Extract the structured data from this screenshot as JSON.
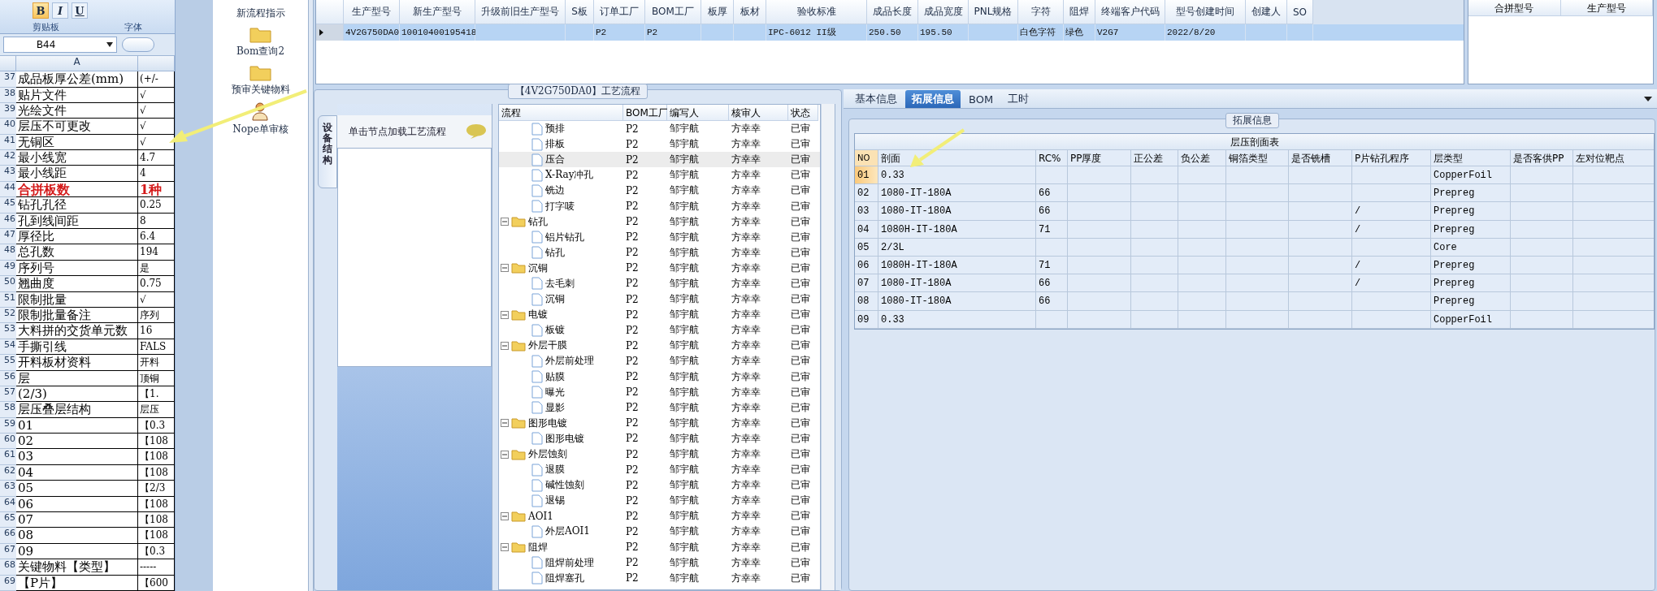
{
  "excel": {
    "format_buttons": [
      {
        "label": "B",
        "on": true
      },
      {
        "label": "I",
        "on": false
      },
      {
        "label": "U",
        "on": false
      }
    ],
    "groups": [
      "剪贴板",
      "字体"
    ],
    "name_box": "B44",
    "column_header": "A",
    "rows": [
      {
        "num": "37",
        "a": "成品板厚公差(mm)",
        "b": "(+/-",
        "emphasis": false
      },
      {
        "num": "38",
        "a": "贴片文件",
        "b": "√",
        "emphasis": false
      },
      {
        "num": "39",
        "a": "光绘文件",
        "b": "√",
        "emphasis": false
      },
      {
        "num": "40",
        "a": "层压不可更改",
        "b": "√",
        "emphasis": false
      },
      {
        "num": "41",
        "a": "无铜区",
        "b": "√",
        "emphasis": false
      },
      {
        "num": "42",
        "a": "最小线宽",
        "b": "4.7",
        "emphasis": false
      },
      {
        "num": "43",
        "a": "最小线距",
        "b": "4",
        "emphasis": false
      },
      {
        "num": "44",
        "a": "合拼板数",
        "b": "1种",
        "emphasis": true
      },
      {
        "num": "45",
        "a": "钻孔孔径",
        "b": "0.25",
        "emphasis": false
      },
      {
        "num": "46",
        "a": "孔到线间距",
        "b": "8",
        "emphasis": false
      },
      {
        "num": "47",
        "a": "厚径比",
        "b": "6.4",
        "emphasis": false
      },
      {
        "num": "48",
        "a": "总孔数",
        "b": "194",
        "emphasis": false
      },
      {
        "num": "49",
        "a": "序列号",
        "b": "是",
        "emphasis": false
      },
      {
        "num": "50",
        "a": "翘曲度",
        "b": "0.75",
        "emphasis": false
      },
      {
        "num": "51",
        "a": "限制批量",
        "b": "√",
        "emphasis": false
      },
      {
        "num": "52",
        "a": "限制批量备注",
        "b": "序列",
        "emphasis": false
      },
      {
        "num": "53",
        "a": "大料拼的交货单元数",
        "b": "16",
        "emphasis": false
      },
      {
        "num": "54",
        "a": "手撕引线",
        "b": "FALS",
        "emphasis": false
      },
      {
        "num": "55",
        "a": "开料板材资料",
        "b": "开料",
        "emphasis": false
      },
      {
        "num": "56",
        "a": "层",
        "b": "顶铜",
        "emphasis": false
      },
      {
        "num": "57",
        "a": "(2/3)",
        "b": "【1.",
        "emphasis": false
      },
      {
        "num": "58",
        "a": "层压叠层结构",
        "b": "层压",
        "emphasis": false
      },
      {
        "num": "59",
        "a": "01",
        "b": "【0.3",
        "emphasis": false
      },
      {
        "num": "60",
        "a": "02",
        "b": "【108",
        "emphasis": false
      },
      {
        "num": "61",
        "a": "03",
        "b": "【108",
        "emphasis": false
      },
      {
        "num": "62",
        "a": "04",
        "b": "【108",
        "emphasis": false
      },
      {
        "num": "63",
        "a": "05",
        "b": "【2/3",
        "emphasis": false
      },
      {
        "num": "64",
        "a": "06",
        "b": "【108",
        "emphasis": false
      },
      {
        "num": "65",
        "a": "07",
        "b": "【108",
        "emphasis": false
      },
      {
        "num": "66",
        "a": "08",
        "b": "【108",
        "emphasis": false
      },
      {
        "num": "67",
        "a": "09",
        "b": "【0.3",
        "emphasis": false
      },
      {
        "num": "68",
        "a": "关键物料【类型】",
        "b": "-----",
        "emphasis": false
      },
      {
        "num": "69",
        "a": "【P片】",
        "b": "【600",
        "emphasis": false
      }
    ]
  },
  "tools": [
    {
      "label": "新流程指示",
      "kind": "text"
    },
    {
      "label": "Bom查询2",
      "kind": "folder"
    },
    {
      "label": "预审关键物料",
      "kind": "folder"
    },
    {
      "label": "Nope单审核",
      "kind": "user"
    }
  ],
  "models_table": {
    "columns": [
      "生产型号",
      "新生产型号",
      "升级前旧生产型号",
      "S板",
      "订单工厂",
      "BOM工厂",
      "板厚",
      "板材",
      "验收标准",
      "成品长度",
      "成品宽度",
      "PNL规格",
      "字符",
      "阻焊",
      "终端客户代码",
      "型号创建时间",
      "创建人",
      "SO"
    ],
    "rows": [
      {
        "selected": true,
        "cells": [
          "4V2G750DA0",
          "10010400195418",
          "",
          "",
          "P2",
          "P2",
          "",
          "",
          "IPC-6012 II级",
          "250.50",
          "195.50",
          "",
          "白色字符",
          "绿色",
          "V2G7",
          "2022/8/20",
          "",
          ""
        ]
      }
    ]
  },
  "merge_panel": {
    "columns": [
      "合拼型号",
      "生产型号"
    ]
  },
  "process": {
    "title": "【4V2G750DA0】工艺流程",
    "side_tab": "设备结构",
    "hint": "单击节点加载工艺流程",
    "columns": [
      "流程",
      "BOM工厂",
      "编写人",
      "核审人",
      "状态"
    ],
    "tree": [
      {
        "kind": "step",
        "name": "预排",
        "factory": "P2",
        "writer": "邹宇航",
        "reviewer": "方幸幸",
        "status": "已审",
        "selected": false
      },
      {
        "kind": "step",
        "name": "排板",
        "factory": "P2",
        "writer": "邹宇航",
        "reviewer": "方幸幸",
        "status": "已审",
        "selected": false
      },
      {
        "kind": "step",
        "name": "压合",
        "factory": "P2",
        "writer": "邹宇航",
        "reviewer": "方幸幸",
        "status": "已审",
        "selected": true
      },
      {
        "kind": "step",
        "name": "X-Ray冲孔",
        "factory": "P2",
        "writer": "邹宇航",
        "reviewer": "方幸幸",
        "status": "已审",
        "selected": false
      },
      {
        "kind": "step",
        "name": "铣边",
        "factory": "P2",
        "writer": "邹宇航",
        "reviewer": "方幸幸",
        "status": "已审",
        "selected": false
      },
      {
        "kind": "step",
        "name": "打字唛",
        "factory": "P2",
        "writer": "邹宇航",
        "reviewer": "方幸幸",
        "status": "已审",
        "selected": false
      },
      {
        "kind": "folder",
        "name": "钻孔",
        "factory": "P2",
        "writer": "邹宇航",
        "reviewer": "方幸幸",
        "status": "已审",
        "selected": false,
        "expanded": true,
        "children": [
          {
            "kind": "step",
            "name": "铝片钻孔",
            "factory": "P2",
            "writer": "邹宇航",
            "reviewer": "方幸幸",
            "status": "已审",
            "selected": false
          },
          {
            "kind": "step",
            "name": "钻孔",
            "factory": "P2",
            "writer": "邹宇航",
            "reviewer": "方幸幸",
            "status": "已审",
            "selected": false
          }
        ]
      },
      {
        "kind": "folder",
        "name": "沉铜",
        "factory": "P2",
        "writer": "邹宇航",
        "reviewer": "方幸幸",
        "status": "已审",
        "selected": false,
        "expanded": true,
        "children": [
          {
            "kind": "step",
            "name": "去毛刺",
            "factory": "P2",
            "writer": "邹宇航",
            "reviewer": "方幸幸",
            "status": "已审",
            "selected": false
          },
          {
            "kind": "step",
            "name": "沉铜",
            "factory": "P2",
            "writer": "邹宇航",
            "reviewer": "方幸幸",
            "status": "已审",
            "selected": false
          }
        ]
      },
      {
        "kind": "folder",
        "name": "电镀",
        "factory": "P2",
        "writer": "邹宇航",
        "reviewer": "方幸幸",
        "status": "已审",
        "selected": false,
        "expanded": true,
        "children": [
          {
            "kind": "step",
            "name": "板镀",
            "factory": "P2",
            "writer": "邹宇航",
            "reviewer": "方幸幸",
            "status": "已审",
            "selected": false
          }
        ]
      },
      {
        "kind": "folder",
        "name": "外层干膜",
        "factory": "P2",
        "writer": "邹宇航",
        "reviewer": "方幸幸",
        "status": "已审",
        "selected": false,
        "expanded": true,
        "children": [
          {
            "kind": "step",
            "name": "外层前处理",
            "factory": "P2",
            "writer": "邹宇航",
            "reviewer": "方幸幸",
            "status": "已审",
            "selected": false
          },
          {
            "kind": "step",
            "name": "贴膜",
            "factory": "P2",
            "writer": "邹宇航",
            "reviewer": "方幸幸",
            "status": "已审",
            "selected": false
          },
          {
            "kind": "step",
            "name": "曝光",
            "factory": "P2",
            "writer": "邹宇航",
            "reviewer": "方幸幸",
            "status": "已审",
            "selected": false
          },
          {
            "kind": "step",
            "name": "显影",
            "factory": "P2",
            "writer": "邹宇航",
            "reviewer": "方幸幸",
            "status": "已审",
            "selected": false
          }
        ]
      },
      {
        "kind": "folder",
        "name": "图形电镀",
        "factory": "P2",
        "writer": "邹宇航",
        "reviewer": "方幸幸",
        "status": "已审",
        "selected": false,
        "expanded": true,
        "children": [
          {
            "kind": "step",
            "name": "图形电镀",
            "factory": "P2",
            "writer": "邹宇航",
            "reviewer": "方幸幸",
            "status": "已审",
            "selected": false
          }
        ]
      },
      {
        "kind": "folder",
        "name": "外层蚀刻",
        "factory": "P2",
        "writer": "邹宇航",
        "reviewer": "方幸幸",
        "status": "已审",
        "selected": false,
        "expanded": true,
        "children": [
          {
            "kind": "step",
            "name": "退膜",
            "factory": "P2",
            "writer": "邹宇航",
            "reviewer": "方幸幸",
            "status": "已审",
            "selected": false
          },
          {
            "kind": "step",
            "name": "碱性蚀刻",
            "factory": "P2",
            "writer": "邹宇航",
            "reviewer": "方幸幸",
            "status": "已审",
            "selected": false
          },
          {
            "kind": "step",
            "name": "退锡",
            "factory": "P2",
            "writer": "邹宇航",
            "reviewer": "方幸幸",
            "status": "已审",
            "selected": false
          }
        ]
      },
      {
        "kind": "folder",
        "name": "AOI1",
        "factory": "P2",
        "writer": "邹宇航",
        "reviewer": "方幸幸",
        "status": "已审",
        "selected": false,
        "expanded": true,
        "children": [
          {
            "kind": "step",
            "name": "外层AOI1",
            "factory": "P2",
            "writer": "邹宇航",
            "reviewer": "方幸幸",
            "status": "已审",
            "selected": false
          }
        ]
      },
      {
        "kind": "folder",
        "name": "阻焊",
        "factory": "P2",
        "writer": "邹宇航",
        "reviewer": "方幸幸",
        "status": "已审",
        "selected": false,
        "expanded": true,
        "children": [
          {
            "kind": "step",
            "name": "阻焊前处理",
            "factory": "P2",
            "writer": "邹宇航",
            "reviewer": "方幸幸",
            "status": "已审",
            "selected": false
          },
          {
            "kind": "step",
            "name": "阻焊塞孔",
            "factory": "P2",
            "writer": "邹宇航",
            "reviewer": "方幸幸",
            "status": "已审",
            "selected": false
          }
        ]
      }
    ]
  },
  "details": {
    "tabs": [
      {
        "label": "基本信息",
        "selected": false
      },
      {
        "label": "拓展信息",
        "selected": true
      },
      {
        "label": "BOM",
        "selected": false
      },
      {
        "label": "工时",
        "selected": false
      }
    ],
    "group_title": "拓展信息",
    "table": {
      "title": "层压剖面表",
      "columns": [
        "NO",
        "剖面",
        "RC%",
        "PP厚度",
        "正公差",
        "负公差",
        "铜箔类型",
        "是否铣槽",
        "P片钻孔程序",
        "层类型",
        "是否客供PP",
        "左对位靶点"
      ],
      "rows": [
        {
          "selected": true,
          "cells": [
            "01",
            "0.33",
            "",
            "",
            "",
            "",
            "",
            "",
            "",
            "CopperFoil",
            "",
            ""
          ]
        },
        {
          "selected": false,
          "cells": [
            "02",
            "1080-IT-180A",
            "66",
            "",
            "",
            "",
            "",
            "",
            "",
            "Prepreg",
            "",
            ""
          ]
        },
        {
          "selected": false,
          "cells": [
            "03",
            "1080-IT-180A",
            "66",
            "",
            "",
            "",
            "",
            "",
            "/",
            "Prepreg",
            "",
            ""
          ]
        },
        {
          "selected": false,
          "cells": [
            "04",
            "1080H-IT-180A",
            "71",
            "",
            "",
            "",
            "",
            "",
            "/",
            "Prepreg",
            "",
            ""
          ]
        },
        {
          "selected": false,
          "cells": [
            "05",
            "2/3L",
            "",
            "",
            "",
            "",
            "",
            "",
            "",
            "Core",
            "",
            ""
          ]
        },
        {
          "selected": false,
          "cells": [
            "06",
            "1080H-IT-180A",
            "71",
            "",
            "",
            "",
            "",
            "",
            "/",
            "Prepreg",
            "",
            ""
          ]
        },
        {
          "selected": false,
          "cells": [
            "07",
            "1080-IT-180A",
            "66",
            "",
            "",
            "",
            "",
            "",
            "/",
            "Prepreg",
            "",
            ""
          ]
        },
        {
          "selected": false,
          "cells": [
            "08",
            "1080-IT-180A",
            "66",
            "",
            "",
            "",
            "",
            "",
            "",
            "Prepreg",
            "",
            ""
          ]
        },
        {
          "selected": false,
          "cells": [
            "09",
            "0.33",
            "",
            "",
            "",
            "",
            "",
            "",
            "",
            "CopperFoil",
            "",
            ""
          ]
        }
      ]
    }
  }
}
